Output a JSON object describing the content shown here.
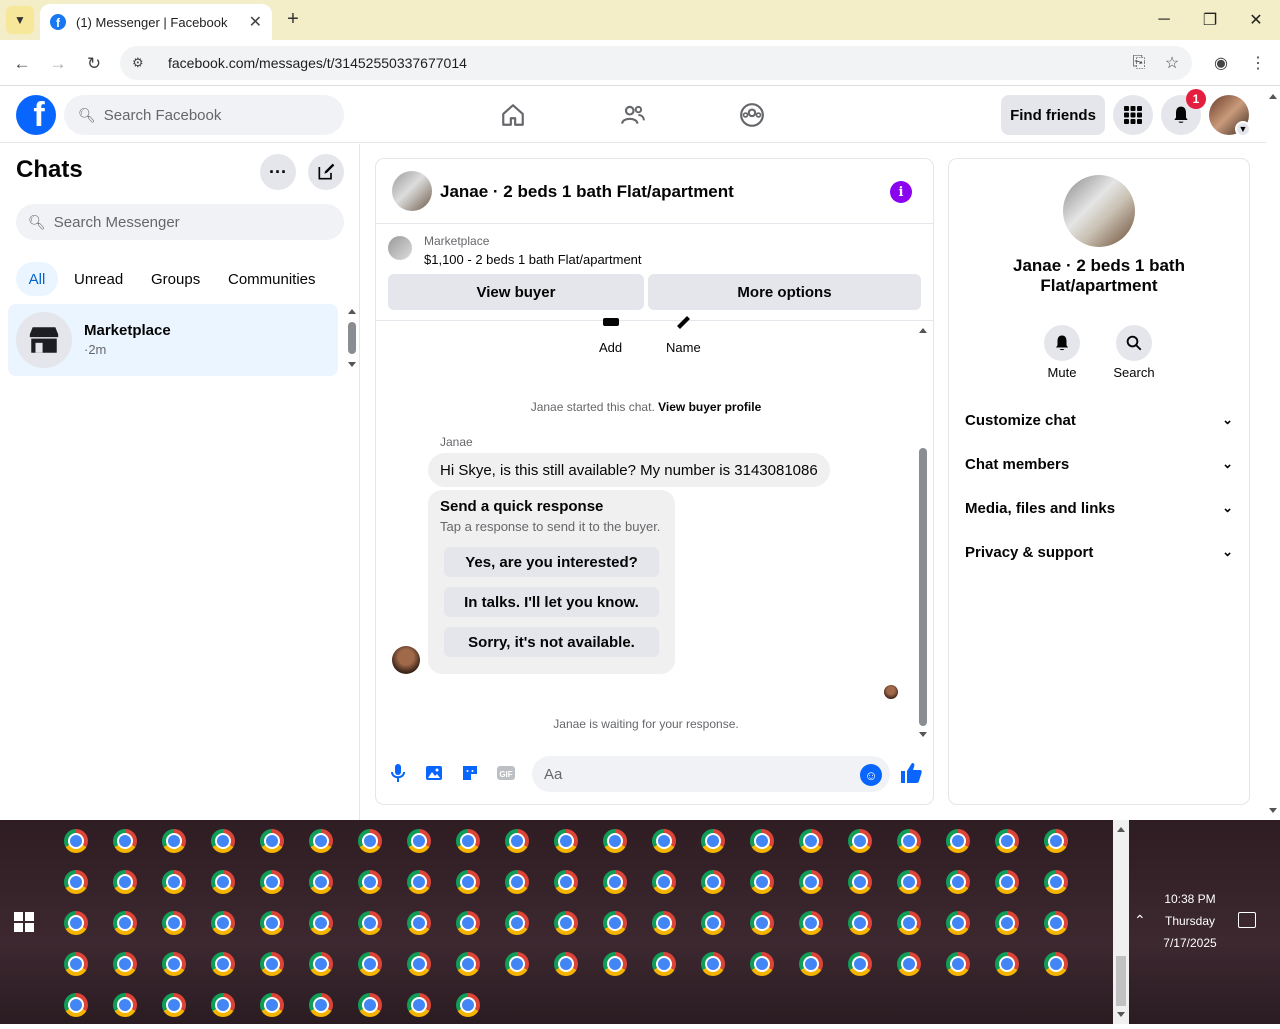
{
  "browser": {
    "tab_title": "(1) Messenger | Facebook",
    "url": "facebook.com/messages/t/31452550337677014"
  },
  "header": {
    "search_placeholder": "Search Facebook",
    "find_friends": "Find friends",
    "notification_count": "1"
  },
  "sidebar": {
    "title": "Chats",
    "search_placeholder": "Search Messenger",
    "filters": [
      "All",
      "Unread",
      "Groups",
      "Communities"
    ],
    "chats": [
      {
        "name": "Marketplace",
        "time": "·2m"
      }
    ]
  },
  "conversation": {
    "title": "Janae · 2 beds 1 bath Flat/apartment",
    "marketplace_label": "Marketplace",
    "listing": "$1,100 - 2 beds 1 bath Flat/apartment",
    "view_buyer": "View buyer",
    "more_options": "More options",
    "add_label": "Add",
    "name_label": "Name",
    "started_text": "Janae started this chat.",
    "view_buyer_profile": "View buyer profile",
    "sender": "Janae",
    "message": "Hi Skye, is this still available? My number is 3143081086",
    "quick_title": "Send a quick response",
    "quick_subtitle": "Tap a response to send it to the buyer.",
    "quick_responses": [
      "Yes, are you interested?",
      "In talks. I'll let you know.",
      "Sorry, it's not available."
    ],
    "waiting": "Janae is waiting for your response.",
    "input_placeholder": "Aa"
  },
  "details": {
    "title": "Janae · 2 beds 1 bath Flat/apartment",
    "mute": "Mute",
    "search": "Search",
    "sections": [
      "Customize chat",
      "Chat members",
      "Media, files and links",
      "Privacy & support"
    ]
  },
  "taskbar": {
    "time": "10:38 PM",
    "day": "Thursday",
    "date": "7/17/2025"
  },
  "colors": {
    "facebook_blue": "#0866ff",
    "active_filter_bg": "#ebf5ff",
    "info_purple": "#8a04f0",
    "badge_red": "#e41e3f"
  }
}
